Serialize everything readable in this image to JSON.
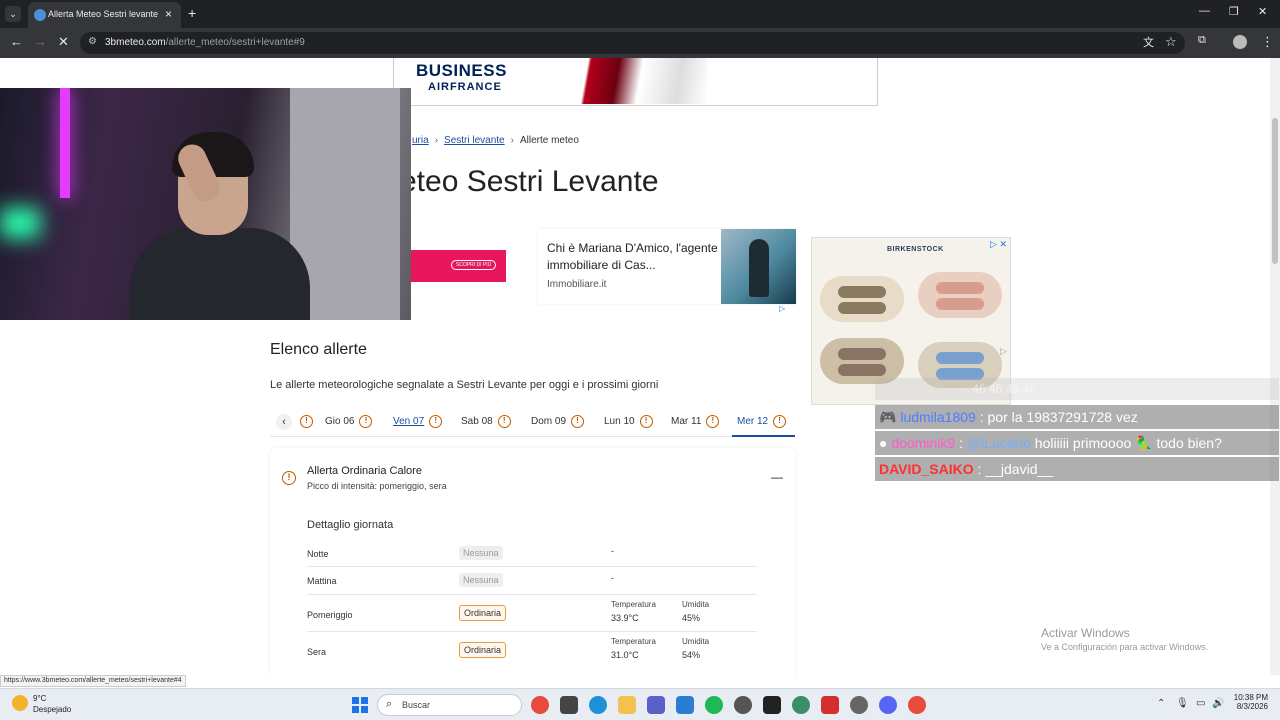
{
  "browser": {
    "tab_title": "Allerta Meteo Sestri levante [Og",
    "url_host": "3bmeteo.com",
    "url_path": "/allerte_meteo/sestri+levante#9",
    "status_url": "https://www.3bmeteo.com/allerte_meteo/sestri+levante#4"
  },
  "ads": {
    "business": "BUSINESS",
    "airfrance": "AIRFRANCE",
    "left_button": "SCOPRI DI PIÙ",
    "card_title": "Chi è Mariana D'Amico, l'agente immobiliare di Cas...",
    "card_source": "Immobiliare.it",
    "birk_logo": "BIRKENSTOCK"
  },
  "breadcrumb": {
    "item1": "uria",
    "item2": "Sestri levante",
    "item3": "Allerte meteo"
  },
  "page_title": "eteo Sestri Levante",
  "section": {
    "title": "Elenco allerte",
    "description": "Le allerte meteorologiche segnalate a Sestri Levante per oggi e i prossimi giorni"
  },
  "day_tabs": [
    {
      "label": "Gio 06"
    },
    {
      "label": "Ven 07"
    },
    {
      "label": "Sab 08"
    },
    {
      "label": "Dom 09"
    },
    {
      "label": "Lun 10"
    },
    {
      "label": "Mar 11"
    },
    {
      "label": "Mer 12"
    }
  ],
  "alert": {
    "title": "Allerta Ordinaria Calore",
    "subtitle": "Picco di intensità: pomeriggio, sera",
    "detail_title": "Dettaglio giornata",
    "rows": [
      {
        "label": "Notte",
        "level": "Nessuna",
        "dash": "-"
      },
      {
        "label": "Mattina",
        "level": "Nessuna",
        "dash": "-"
      },
      {
        "label": "Pomeriggio",
        "level": "Ordinaria",
        "temp_label": "Temperatura",
        "temp": "33.9°C",
        "hum_label": "Umidita",
        "hum": "45%"
      },
      {
        "label": "Sera",
        "level": "Ordinaria",
        "temp_label": "Temperatura",
        "temp": "31.0°C",
        "hum_label": "Umidita",
        "hum": "54%"
      }
    ]
  },
  "chat": {
    "faded": "· 46.46.46.46",
    "msg1_user": "ludmila1809",
    "msg1_text": ": por la 19837291728 vez",
    "msg2_user": "doominik9",
    "msg2_sep": " : ",
    "msg2_mention": "@iLucarto",
    "msg2_text": " holiiiii primoooo 🦜 todo bien?",
    "msg3_user": "DAVID_SAIKO",
    "msg3_text": ": __jdavid__"
  },
  "watermark": {
    "line1": "Activar Windows",
    "line2": "Ve a Configuración para activar Windows."
  },
  "taskbar": {
    "temp": "9°C",
    "condition": "Despejado",
    "search_placeholder": "Buscar",
    "time": "10:38 PM",
    "date": "8/3/2026"
  },
  "colors": {
    "accent": "#1a4fa0",
    "alert_orange": "#c25b00",
    "chrome_dark": "#202124"
  }
}
